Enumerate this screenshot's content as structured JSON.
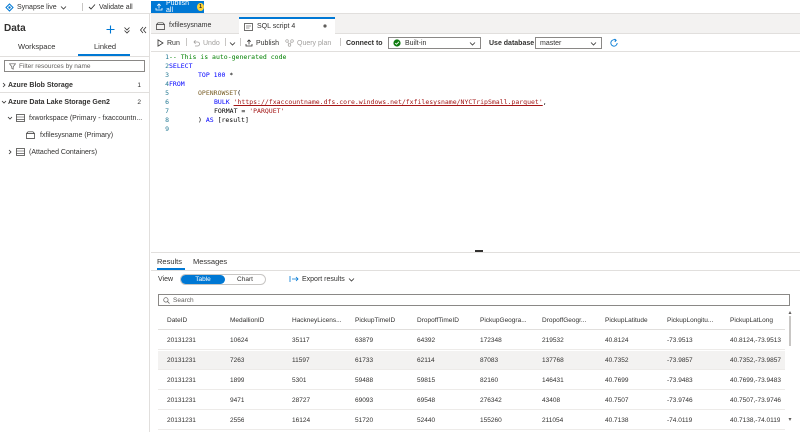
{
  "topbar": {
    "workspace_mode": "Synapse live",
    "validate_label": "Validate all",
    "publish_label": "Publish all",
    "publish_count": "1"
  },
  "left_panel": {
    "title": "Data",
    "tabs": [
      "Workspace",
      "Linked"
    ],
    "active_tab": "Linked",
    "filter_placeholder": "Filter resources by name",
    "sections": [
      {
        "label": "Azure Blob Storage",
        "count": "1"
      },
      {
        "label": "Azure Data Lake Storage Gen2",
        "count": "2"
      }
    ],
    "tree": [
      {
        "label": "fxworkspace (Primary - fxaccountn..."
      },
      {
        "label": "fxfilesysname (Primary)"
      },
      {
        "label": "(Attached Containers)"
      }
    ]
  },
  "editor": {
    "tabs": [
      {
        "label": "fxfilesysname"
      },
      {
        "label": "SQL script 4"
      }
    ]
  },
  "toolbar": {
    "run": "Run",
    "undo": "Undo",
    "publish": "Publish",
    "query_plan": "Query plan",
    "connect_to_label": "Connect to",
    "connect_to_value": "Built-in",
    "use_database_label": "Use database",
    "use_database_value": "master"
  },
  "code": {
    "line_numbers": [
      "1",
      "2",
      "3",
      "4",
      "5",
      "6",
      "7",
      "8",
      "9"
    ],
    "l1": "-- This is auto-generated code",
    "l2": "SELECT",
    "l3a": "TOP 100",
    "l3b": " *",
    "l4": "FROM",
    "l5a": "OPENROWSET",
    "l5b": "(",
    "l6a": "BULK",
    "l6b": "'https://fxaccountname.dfs.core.windows.net/fxfilesysname/NYCTripSmall.parquet'",
    "l6c": ",",
    "l7a": "FORMAT = ",
    "l7b": "'PARQUET'",
    "l8a": ") ",
    "l8b": "AS",
    "l8c": " [result]"
  },
  "results": {
    "tabs": [
      "Results",
      "Messages"
    ],
    "view_label": "View",
    "toggle": [
      "Table",
      "Chart"
    ],
    "export_label": "Export results",
    "search_placeholder": "Search",
    "columns": [
      "DateID",
      "MedallionID",
      "HackneyLicens...",
      "PickupTimeID",
      "DropoffTimeID",
      "PickupGeogra...",
      "DropoffGeogr...",
      "PickupLatitude",
      "PickupLongitu...",
      "PickupLatLong"
    ],
    "rows": [
      [
        "20131231",
        "10624",
        "35117",
        "63879",
        "64392",
        "172348",
        "219532",
        "40.8124",
        "-73.9513",
        "40.8124,-73.9513"
      ],
      [
        "20131231",
        "7263",
        "11597",
        "61733",
        "62114",
        "87083",
        "137768",
        "40.7352",
        "-73.9857",
        "40.7352,-73.9857"
      ],
      [
        "20131231",
        "1899",
        "5301",
        "59488",
        "59815",
        "82160",
        "146431",
        "40.7699",
        "-73.9483",
        "40.7699,-73.9483"
      ],
      [
        "20131231",
        "9471",
        "28727",
        "69093",
        "69548",
        "276342",
        "43408",
        "40.7507",
        "-73.9746",
        "40.7507,-73.9746"
      ],
      [
        "20131231",
        "2556",
        "16124",
        "51720",
        "52440",
        "155260",
        "211054",
        "40.7138",
        "-74.0119",
        "40.7138,-74.0119"
      ]
    ]
  },
  "colors": {
    "accent": "#0078d4",
    "badge": "#ffd335",
    "comment": "#008000",
    "keyword": "#0000ff",
    "string": "#a31515"
  }
}
